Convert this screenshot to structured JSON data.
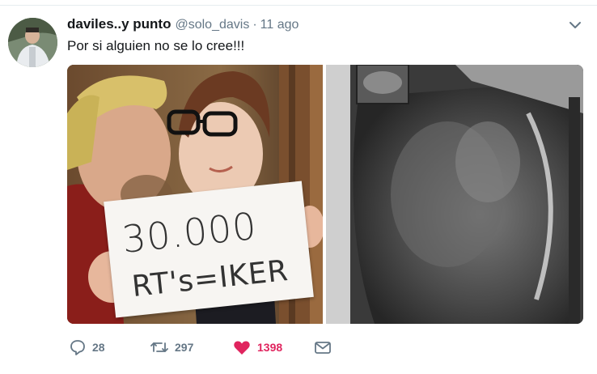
{
  "tweet": {
    "display_name": "daviles..y punto",
    "handle": "@solo_davis",
    "separator": "·",
    "timestamp": "11 ago",
    "text": "Por si alguien no se lo cree!!!"
  },
  "media": {
    "sign_line1": "30.000",
    "sign_line2": "RT's=IKER"
  },
  "actions": {
    "replies": "28",
    "retweets": "297",
    "likes": "1398"
  },
  "icons": {
    "reply": "reply-icon",
    "retweet": "retweet-icon",
    "like": "heart-icon",
    "dm": "envelope-icon",
    "caret": "chevron-down-icon"
  },
  "colors": {
    "like_active": "#e0245e",
    "muted": "#657786",
    "text": "#14171a"
  }
}
